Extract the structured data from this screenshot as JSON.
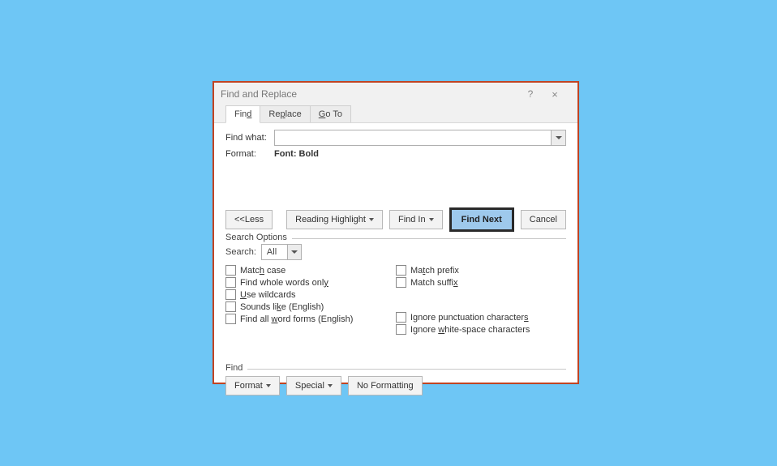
{
  "dialog": {
    "title": "Find and Replace",
    "help": "?",
    "close": "×"
  },
  "tabs": {
    "find": "Find",
    "replace": "Replace",
    "goto": "Go To"
  },
  "fields": {
    "find_what_label": "Find what:",
    "find_what_value": "",
    "format_label": "Format:",
    "format_value": "Font: Bold"
  },
  "buttons": {
    "less": "<< Less",
    "reading_highlight": "Reading Highlight",
    "find_in": "Find In",
    "find_next": "Find Next",
    "cancel": "Cancel",
    "format": "Format",
    "special": "Special",
    "no_formatting": "No Formatting"
  },
  "search_options": {
    "legend": "Search Options",
    "search_label": "Search:",
    "search_value": "All",
    "left": {
      "match_case": "Match case",
      "whole_words": "Find whole words only",
      "wildcards": "Use wildcards",
      "sounds_like": "Sounds like (English)",
      "word_forms": "Find all word forms (English)"
    },
    "right": {
      "match_prefix": "Match prefix",
      "match_suffix": "Match suffix",
      "ignore_punct": "Ignore punctuation characters",
      "ignore_ws": "Ignore white-space characters"
    }
  },
  "find_group": {
    "legend": "Find"
  }
}
